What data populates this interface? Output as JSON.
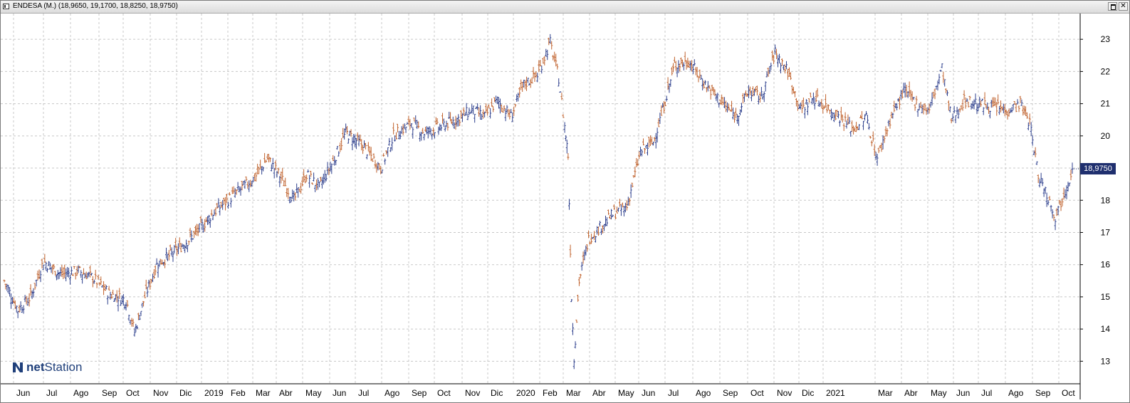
{
  "window": {
    "title": "ENDESA (M.) (18,9650, 19,1700, 18,8250, 18,9750)",
    "close_glyph": "✕"
  },
  "logo": {
    "part1": "net",
    "part2": "Station"
  },
  "last_price_label": "18,9750",
  "colors": {
    "up": "#2c3e8c",
    "down": "#c0622d",
    "grid": "#c8c8c8",
    "badge": "#1f2f6e"
  },
  "chart_data": {
    "type": "ohlc",
    "title": "ENDESA (M.)",
    "last": {
      "open": 18.965,
      "high": 19.17,
      "low": 18.825,
      "close": 18.975
    },
    "y_ticks": [
      13,
      14,
      15,
      16,
      17,
      18,
      19,
      20,
      21,
      22,
      23
    ],
    "ylim": [
      12.3,
      23.8
    ],
    "x_labels": [
      "Jun",
      "Jul",
      "Ago",
      "Sep",
      "Oct",
      "Nov",
      "Dic",
      "2019",
      "Feb",
      "Mar",
      "Abr",
      "May",
      "Jun",
      "Jul",
      "Ago",
      "Sep",
      "Oct",
      "Nov",
      "Dic",
      "2020",
      "Feb",
      "Mar",
      "Abr",
      "May",
      "Jun",
      "Jul",
      "Ago",
      "Sep",
      "Oct",
      "Nov",
      "Dic",
      "2021",
      "Mar",
      "Abr",
      "May",
      "Jun",
      "Jul",
      "Ago",
      "Sep",
      "Oct"
    ],
    "grid": true,
    "price_path": [
      [
        "2018-05-20",
        15.5
      ],
      [
        "2018-06-05",
        14.6
      ],
      [
        "2018-06-20",
        15.0
      ],
      [
        "2018-07-05",
        16.1
      ],
      [
        "2018-07-25",
        15.7
      ],
      [
        "2018-08-15",
        15.8
      ],
      [
        "2018-09-01",
        15.6
      ],
      [
        "2018-09-20",
        15.1
      ],
      [
        "2018-10-10",
        14.9
      ],
      [
        "2018-10-20",
        13.9
      ],
      [
        "2018-11-01",
        15.0
      ],
      [
        "2018-11-15",
        16.0
      ],
      [
        "2018-12-01",
        16.3
      ],
      [
        "2018-12-15",
        16.6
      ],
      [
        "2019-01-01",
        17.0
      ],
      [
        "2019-01-20",
        17.6
      ],
      [
        "2019-02-15",
        18.2
      ],
      [
        "2019-03-10",
        18.7
      ],
      [
        "2019-03-25",
        19.3
      ],
      [
        "2019-04-10",
        18.7
      ],
      [
        "2019-04-25",
        18.0
      ],
      [
        "2019-05-10",
        18.8
      ],
      [
        "2019-05-25",
        18.4
      ],
      [
        "2019-06-10",
        19.2
      ],
      [
        "2019-06-25",
        20.1
      ],
      [
        "2019-07-15",
        19.7
      ],
      [
        "2019-08-05",
        19.0
      ],
      [
        "2019-08-20",
        20.0
      ],
      [
        "2019-09-10",
        20.4
      ],
      [
        "2019-09-25",
        20.1
      ],
      [
        "2019-10-15",
        20.3
      ],
      [
        "2019-11-01",
        20.5
      ],
      [
        "2019-11-20",
        20.8
      ],
      [
        "2019-12-05",
        20.6
      ],
      [
        "2019-12-20",
        21.1
      ],
      [
        "2020-01-05",
        20.6
      ],
      [
        "2020-01-20",
        21.6
      ],
      [
        "2020-02-05",
        21.9
      ],
      [
        "2020-02-20",
        22.9
      ],
      [
        "2020-03-01",
        21.8
      ],
      [
        "2020-03-08",
        20.3
      ],
      [
        "2020-03-12",
        19.4
      ],
      [
        "2020-03-16",
        15.0
      ],
      [
        "2020-03-19",
        13.1
      ],
      [
        "2020-03-25",
        15.5
      ],
      [
        "2020-04-05",
        16.8
      ],
      [
        "2020-04-20",
        17.2
      ],
      [
        "2020-05-05",
        17.6
      ],
      [
        "2020-05-20",
        17.8
      ],
      [
        "2020-06-05",
        19.5
      ],
      [
        "2020-06-20",
        19.8
      ],
      [
        "2020-07-01",
        20.8
      ],
      [
        "2020-07-15",
        22.2
      ],
      [
        "2020-08-01",
        22.3
      ],
      [
        "2020-08-20",
        21.6
      ],
      [
        "2020-09-10",
        21.0
      ],
      [
        "2020-09-25",
        20.6
      ],
      [
        "2020-10-10",
        21.4
      ],
      [
        "2020-10-25",
        21.2
      ],
      [
        "2020-11-10",
        22.6
      ],
      [
        "2020-11-25",
        22.0
      ],
      [
        "2020-12-10",
        20.8
      ],
      [
        "2020-12-25",
        21.2
      ],
      [
        "2021-01-10",
        20.9
      ],
      [
        "2021-01-25",
        20.6
      ],
      [
        "2021-02-10",
        20.2
      ],
      [
        "2021-02-25",
        20.6
      ],
      [
        "2021-03-10",
        19.3
      ],
      [
        "2021-03-25",
        20.5
      ],
      [
        "2021-04-10",
        21.4
      ],
      [
        "2021-04-25",
        21.0
      ],
      [
        "2021-05-10",
        20.8
      ],
      [
        "2021-05-25",
        22.1
      ],
      [
        "2021-06-05",
        20.5
      ],
      [
        "2021-06-20",
        21.1
      ],
      [
        "2021-07-05",
        21.0
      ],
      [
        "2021-07-25",
        20.9
      ],
      [
        "2021-08-10",
        20.8
      ],
      [
        "2021-08-25",
        21.0
      ],
      [
        "2021-09-05",
        20.4
      ],
      [
        "2021-09-15",
        18.8
      ],
      [
        "2021-09-25",
        18.2
      ],
      [
        "2021-10-05",
        17.5
      ],
      [
        "2021-10-15",
        18.2
      ],
      [
        "2021-10-25",
        18.95
      ]
    ]
  }
}
